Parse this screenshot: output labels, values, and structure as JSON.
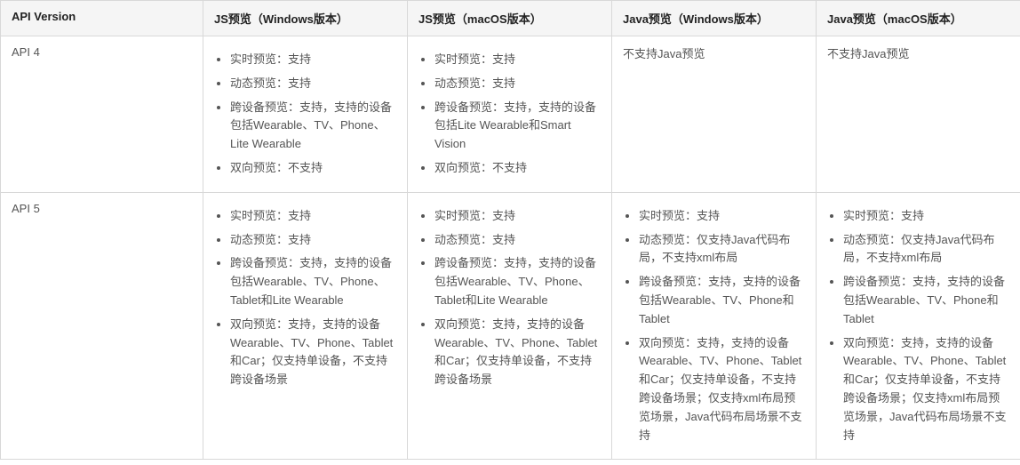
{
  "headers": [
    "API Version",
    "JS预览（Windows版本）",
    "JS预览（macOS版本）",
    "Java预览（Windows版本）",
    "Java预览（macOS版本）"
  ],
  "rows": [
    {
      "label": "API 4",
      "cells": [
        {
          "type": "list",
          "items": [
            "实时预览：支持",
            "动态预览：支持",
            "跨设备预览：支持，支持的设备包括Wearable、TV、Phone、Lite Wearable",
            "双向预览：不支持"
          ]
        },
        {
          "type": "list",
          "items": [
            "实时预览：支持",
            "动态预览：支持",
            "跨设备预览：支持，支持的设备包括Lite Wearable和Smart Vision",
            "双向预览：不支持"
          ]
        },
        {
          "type": "text",
          "text": "不支持Java预览"
        },
        {
          "type": "text",
          "text": "不支持Java预览"
        }
      ]
    },
    {
      "label": "API 5",
      "cells": [
        {
          "type": "list",
          "items": [
            "实时预览：支持",
            "动态预览：支持",
            "跨设备预览：支持，支持的设备包括Wearable、TV、Phone、Tablet和Lite Wearable",
            "双向预览：支持，支持的设备Wearable、TV、Phone、Tablet和Car；仅支持单设备，不支持跨设备场景"
          ]
        },
        {
          "type": "list",
          "items": [
            "实时预览：支持",
            "动态预览：支持",
            "跨设备预览：支持，支持的设备包括Wearable、TV、Phone、Tablet和Lite Wearable",
            "双向预览：支持，支持的设备Wearable、TV、Phone、Tablet和Car；仅支持单设备，不支持跨设备场景"
          ]
        },
        {
          "type": "list",
          "items": [
            "实时预览：支持",
            "动态预览：仅支持Java代码布局，不支持xml布局",
            "跨设备预览：支持，支持的设备包括Wearable、TV、Phone和Tablet",
            "双向预览：支持，支持的设备Wearable、TV、Phone、Tablet和Car；仅支持单设备，不支持跨设备场景；仅支持xml布局预览场景，Java代码布局场景不支持"
          ]
        },
        {
          "type": "list",
          "items": [
            "实时预览：支持",
            "动态预览：仅支持Java代码布局，不支持xml布局",
            "跨设备预览：支持，支持的设备包括Wearable、TV、Phone和Tablet",
            "双向预览：支持，支持的设备Wearable、TV、Phone、Tablet和Car；仅支持单设备，不支持跨设备场景；仅支持xml布局预览场景，Java代码布局场景不支持"
          ]
        }
      ]
    }
  ]
}
